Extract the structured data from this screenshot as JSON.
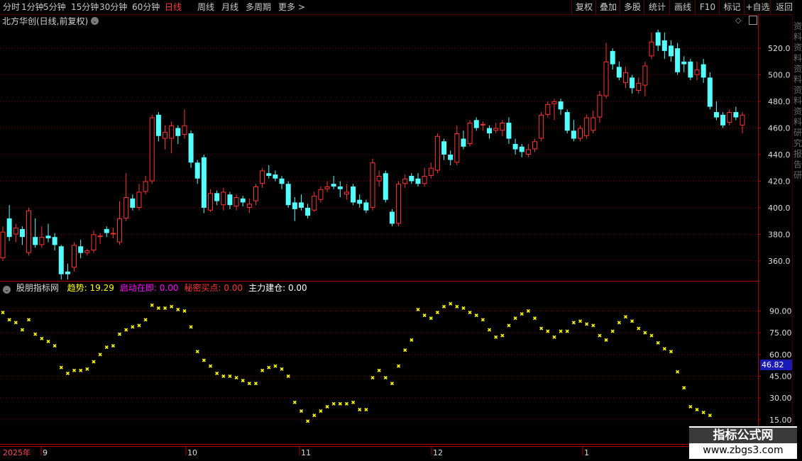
{
  "toolbar": {
    "periods": [
      "分时",
      "1分钟",
      "5分钟",
      "15分钟",
      "30分钟",
      "60分钟",
      "日线",
      "周线",
      "月线",
      "多周期",
      "更多 >"
    ],
    "active_period": "日线",
    "right_buttons": [
      "复权",
      "叠加",
      "多股",
      "统计",
      "画线",
      "F10",
      "标记",
      "+自选",
      "返回"
    ]
  },
  "main_title": "北方华创(日线,前复权)",
  "indicator": {
    "name": "股朋指标网",
    "items": [
      {
        "label": "趋势:",
        "value": "19.29",
        "color": "#ffff00"
      },
      {
        "label": "启动在即:",
        "value": "0.00",
        "color": "#ff00ff"
      },
      {
        "label": "秘密买点:",
        "value": "0.00",
        "color": "#ff3333"
      },
      {
        "label": "主力建仓:",
        "value": "0.00",
        "color": "#ffffff"
      }
    ],
    "current_value": "46.82"
  },
  "watermark": {
    "title": "指标公式网",
    "url": "www.zbgs3.com"
  },
  "right_strip_text": "资料资料资料资料资料研究报告研",
  "colors": {
    "up": "#ff3232",
    "down": "#54ffff",
    "grid": "#7a0000",
    "axis_text": "#dddddd",
    "ind": "#ffff00"
  },
  "chart_data": [
    {
      "type": "candlestick",
      "title": "北方华创(日线,前复权)",
      "ylim": [
        345,
        535
      ],
      "y_ticks": [
        "360.0",
        "380.0",
        "400.0",
        "420.0",
        "440.0",
        "460.0",
        "480.0",
        "500.0",
        "520.0"
      ],
      "x_labels": [
        "2025年",
        "9",
        "10",
        "11",
        "12",
        "1"
      ],
      "candles": [
        {
          "o": 362,
          "c": 382,
          "h": 386,
          "l": 360
        },
        {
          "o": 392,
          "c": 378,
          "h": 402,
          "l": 375
        },
        {
          "o": 380,
          "c": 385,
          "h": 388,
          "l": 374
        },
        {
          "o": 384,
          "c": 378,
          "h": 386,
          "l": 372
        },
        {
          "o": 366,
          "c": 398,
          "h": 400,
          "l": 364
        },
        {
          "o": 378,
          "c": 372,
          "h": 392,
          "l": 370
        },
        {
          "o": 372,
          "c": 378,
          "h": 386,
          "l": 370
        },
        {
          "o": 379,
          "c": 377,
          "h": 388,
          "l": 374
        },
        {
          "o": 378,
          "c": 372,
          "h": 381,
          "l": 368
        },
        {
          "o": 371,
          "c": 350,
          "h": 372,
          "l": 346
        },
        {
          "o": 352,
          "c": 350,
          "h": 358,
          "l": 346
        },
        {
          "o": 355,
          "c": 372,
          "h": 374,
          "l": 352
        },
        {
          "o": 371,
          "c": 366,
          "h": 376,
          "l": 362
        },
        {
          "o": 366,
          "c": 368,
          "h": 369,
          "l": 364
        },
        {
          "o": 368,
          "c": 380,
          "h": 383,
          "l": 366
        },
        {
          "o": 378,
          "c": 379,
          "h": 381,
          "l": 373
        },
        {
          "o": 384,
          "c": 381,
          "h": 386,
          "l": 378
        },
        {
          "o": 380,
          "c": 381,
          "h": 385,
          "l": 377
        },
        {
          "o": 374,
          "c": 392,
          "h": 405,
          "l": 372
        },
        {
          "o": 392,
          "c": 408,
          "h": 426,
          "l": 390
        },
        {
          "o": 407,
          "c": 400,
          "h": 410,
          "l": 398
        },
        {
          "o": 400,
          "c": 412,
          "h": 418,
          "l": 398
        },
        {
          "o": 412,
          "c": 420,
          "h": 424,
          "l": 410
        },
        {
          "o": 420,
          "c": 468,
          "h": 470,
          "l": 418
        },
        {
          "o": 470,
          "c": 454,
          "h": 472,
          "l": 450
        },
        {
          "o": 452,
          "c": 457,
          "h": 462,
          "l": 444
        },
        {
          "o": 452,
          "c": 462,
          "h": 465,
          "l": 441
        },
        {
          "o": 460,
          "c": 454,
          "h": 462,
          "l": 448
        },
        {
          "o": 455,
          "c": 462,
          "h": 474,
          "l": 452
        },
        {
          "o": 456,
          "c": 434,
          "h": 458,
          "l": 430
        },
        {
          "o": 434,
          "c": 422,
          "h": 436,
          "l": 418
        },
        {
          "o": 438,
          "c": 400,
          "h": 440,
          "l": 396
        },
        {
          "o": 398,
          "c": 411,
          "h": 414,
          "l": 397
        },
        {
          "o": 411,
          "c": 405,
          "h": 413,
          "l": 402
        },
        {
          "o": 402,
          "c": 412,
          "h": 415,
          "l": 398
        },
        {
          "o": 410,
          "c": 402,
          "h": 412,
          "l": 399
        },
        {
          "o": 401,
          "c": 408,
          "h": 410,
          "l": 398
        },
        {
          "o": 407,
          "c": 404,
          "h": 409,
          "l": 401
        },
        {
          "o": 400,
          "c": 403,
          "h": 407,
          "l": 396
        },
        {
          "o": 405,
          "c": 416,
          "h": 418,
          "l": 402
        },
        {
          "o": 418,
          "c": 428,
          "h": 430,
          "l": 415
        },
        {
          "o": 426,
          "c": 424,
          "h": 432,
          "l": 422
        },
        {
          "o": 425,
          "c": 422,
          "h": 428,
          "l": 420
        },
        {
          "o": 422,
          "c": 418,
          "h": 424,
          "l": 414
        },
        {
          "o": 418,
          "c": 402,
          "h": 420,
          "l": 400
        },
        {
          "o": 404,
          "c": 399,
          "h": 408,
          "l": 390
        },
        {
          "o": 404,
          "c": 400,
          "h": 410,
          "l": 398
        },
        {
          "o": 400,
          "c": 394,
          "h": 403,
          "l": 392
        },
        {
          "o": 398,
          "c": 409,
          "h": 412,
          "l": 397
        },
        {
          "o": 406,
          "c": 414,
          "h": 416,
          "l": 404
        },
        {
          "o": 414,
          "c": 416,
          "h": 420,
          "l": 412
        },
        {
          "o": 418,
          "c": 416,
          "h": 424,
          "l": 414
        },
        {
          "o": 416,
          "c": 414,
          "h": 420,
          "l": 408
        },
        {
          "o": 410,
          "c": 412,
          "h": 418,
          "l": 406
        },
        {
          "o": 416,
          "c": 404,
          "h": 418,
          "l": 402
        },
        {
          "o": 406,
          "c": 403,
          "h": 410,
          "l": 400
        },
        {
          "o": 404,
          "c": 398,
          "h": 406,
          "l": 396
        },
        {
          "o": 400,
          "c": 434,
          "h": 437,
          "l": 398
        },
        {
          "o": 420,
          "c": 424,
          "h": 428,
          "l": 416
        },
        {
          "o": 426,
          "c": 406,
          "h": 428,
          "l": 404
        },
        {
          "o": 397,
          "c": 388,
          "h": 399,
          "l": 386
        },
        {
          "o": 388,
          "c": 418,
          "h": 420,
          "l": 386
        },
        {
          "o": 418,
          "c": 422,
          "h": 425,
          "l": 415
        },
        {
          "o": 424,
          "c": 420,
          "h": 426,
          "l": 418
        },
        {
          "o": 422,
          "c": 418,
          "h": 426,
          "l": 416
        },
        {
          "o": 418,
          "c": 424,
          "h": 430,
          "l": 416
        },
        {
          "o": 424,
          "c": 430,
          "h": 434,
          "l": 422
        },
        {
          "o": 428,
          "c": 454,
          "h": 456,
          "l": 426
        },
        {
          "o": 450,
          "c": 440,
          "h": 452,
          "l": 436
        },
        {
          "o": 440,
          "c": 436,
          "h": 443,
          "l": 432
        },
        {
          "o": 434,
          "c": 456,
          "h": 462,
          "l": 432
        },
        {
          "o": 452,
          "c": 446,
          "h": 458,
          "l": 444
        },
        {
          "o": 448,
          "c": 464,
          "h": 466,
          "l": 446
        },
        {
          "o": 466,
          "c": 460,
          "h": 468,
          "l": 458
        },
        {
          "o": 462,
          "c": 463,
          "h": 465,
          "l": 458
        },
        {
          "o": 460,
          "c": 456,
          "h": 462,
          "l": 452
        },
        {
          "o": 458,
          "c": 460,
          "h": 464,
          "l": 456
        },
        {
          "o": 458,
          "c": 464,
          "h": 466,
          "l": 454
        },
        {
          "o": 464,
          "c": 452,
          "h": 468,
          "l": 448
        },
        {
          "o": 448,
          "c": 444,
          "h": 452,
          "l": 440
        },
        {
          "o": 446,
          "c": 442,
          "h": 448,
          "l": 438
        },
        {
          "o": 440,
          "c": 444,
          "h": 448,
          "l": 438
        },
        {
          "o": 444,
          "c": 450,
          "h": 452,
          "l": 442
        },
        {
          "o": 452,
          "c": 470,
          "h": 472,
          "l": 450
        },
        {
          "o": 470,
          "c": 478,
          "h": 480,
          "l": 468
        },
        {
          "o": 478,
          "c": 480,
          "h": 482,
          "l": 466
        },
        {
          "o": 480,
          "c": 474,
          "h": 482,
          "l": 470
        },
        {
          "o": 472,
          "c": 458,
          "h": 474,
          "l": 456
        },
        {
          "o": 458,
          "c": 452,
          "h": 466,
          "l": 450
        },
        {
          "o": 452,
          "c": 460,
          "h": 462,
          "l": 450
        },
        {
          "o": 454,
          "c": 468,
          "h": 470,
          "l": 452
        },
        {
          "o": 458,
          "c": 468,
          "h": 473,
          "l": 456
        },
        {
          "o": 468,
          "c": 485,
          "h": 488,
          "l": 464
        },
        {
          "o": 484,
          "c": 510,
          "h": 524,
          "l": 482
        },
        {
          "o": 518,
          "c": 508,
          "h": 520,
          "l": 504
        },
        {
          "o": 506,
          "c": 498,
          "h": 510,
          "l": 496
        },
        {
          "o": 494,
          "c": 502,
          "h": 506,
          "l": 490
        },
        {
          "o": 498,
          "c": 490,
          "h": 500,
          "l": 486
        },
        {
          "o": 488,
          "c": 494,
          "h": 498,
          "l": 486
        },
        {
          "o": 492,
          "c": 507,
          "h": 510,
          "l": 484
        },
        {
          "o": 514,
          "c": 525,
          "h": 532,
          "l": 512
        },
        {
          "o": 532,
          "c": 522,
          "h": 534,
          "l": 518
        },
        {
          "o": 526,
          "c": 518,
          "h": 532,
          "l": 512
        },
        {
          "o": 522,
          "c": 514,
          "h": 526,
          "l": 510
        },
        {
          "o": 520,
          "c": 502,
          "h": 524,
          "l": 500
        },
        {
          "o": 510,
          "c": 508,
          "h": 514,
          "l": 502
        },
        {
          "o": 510,
          "c": 498,
          "h": 512,
          "l": 496
        },
        {
          "o": 500,
          "c": 504,
          "h": 510,
          "l": 496
        },
        {
          "o": 508,
          "c": 498,
          "h": 512,
          "l": 494
        },
        {
          "o": 498,
          "c": 476,
          "h": 502,
          "l": 474
        },
        {
          "o": 472,
          "c": 468,
          "h": 480,
          "l": 466
        },
        {
          "o": 470,
          "c": 462,
          "h": 472,
          "l": 460
        },
        {
          "o": 464,
          "c": 472,
          "h": 474,
          "l": 462
        },
        {
          "o": 472,
          "c": 468,
          "h": 476,
          "l": 466
        },
        {
          "o": 462,
          "c": 470,
          "h": 472,
          "l": 456
        }
      ]
    },
    {
      "type": "scatter",
      "title": "股朋指标网",
      "ylim": [
        11,
        101
      ],
      "y_ticks": [
        "15.00",
        "30.00",
        "45.00",
        "60.00",
        "75.00",
        "90.00"
      ],
      "series": [
        {
          "name": "趋势",
          "values": [
            89,
            84,
            82,
            77,
            84,
            74,
            71,
            69,
            66,
            51,
            47,
            49,
            49,
            50,
            55,
            60,
            65,
            66,
            74,
            77,
            79,
            80,
            84,
            94,
            92,
            92,
            93,
            91,
            90,
            79,
            62,
            56,
            52,
            47,
            45,
            45,
            44,
            42,
            40,
            40,
            49,
            51,
            52,
            50,
            45,
            27,
            21,
            14,
            18,
            21,
            24,
            26,
            26,
            26,
            27,
            22,
            22,
            44,
            49,
            44,
            40,
            52,
            63,
            70,
            91,
            87,
            85,
            89,
            93,
            95,
            93,
            92,
            89,
            87,
            84,
            77,
            72,
            73,
            80,
            85,
            88,
            90,
            85,
            78,
            76,
            72,
            76,
            76,
            82,
            83,
            81,
            80,
            73,
            70,
            76,
            82,
            86,
            83,
            78,
            75,
            73,
            68,
            64,
            62,
            48,
            37,
            24,
            22,
            20,
            18
          ]
        }
      ]
    }
  ]
}
